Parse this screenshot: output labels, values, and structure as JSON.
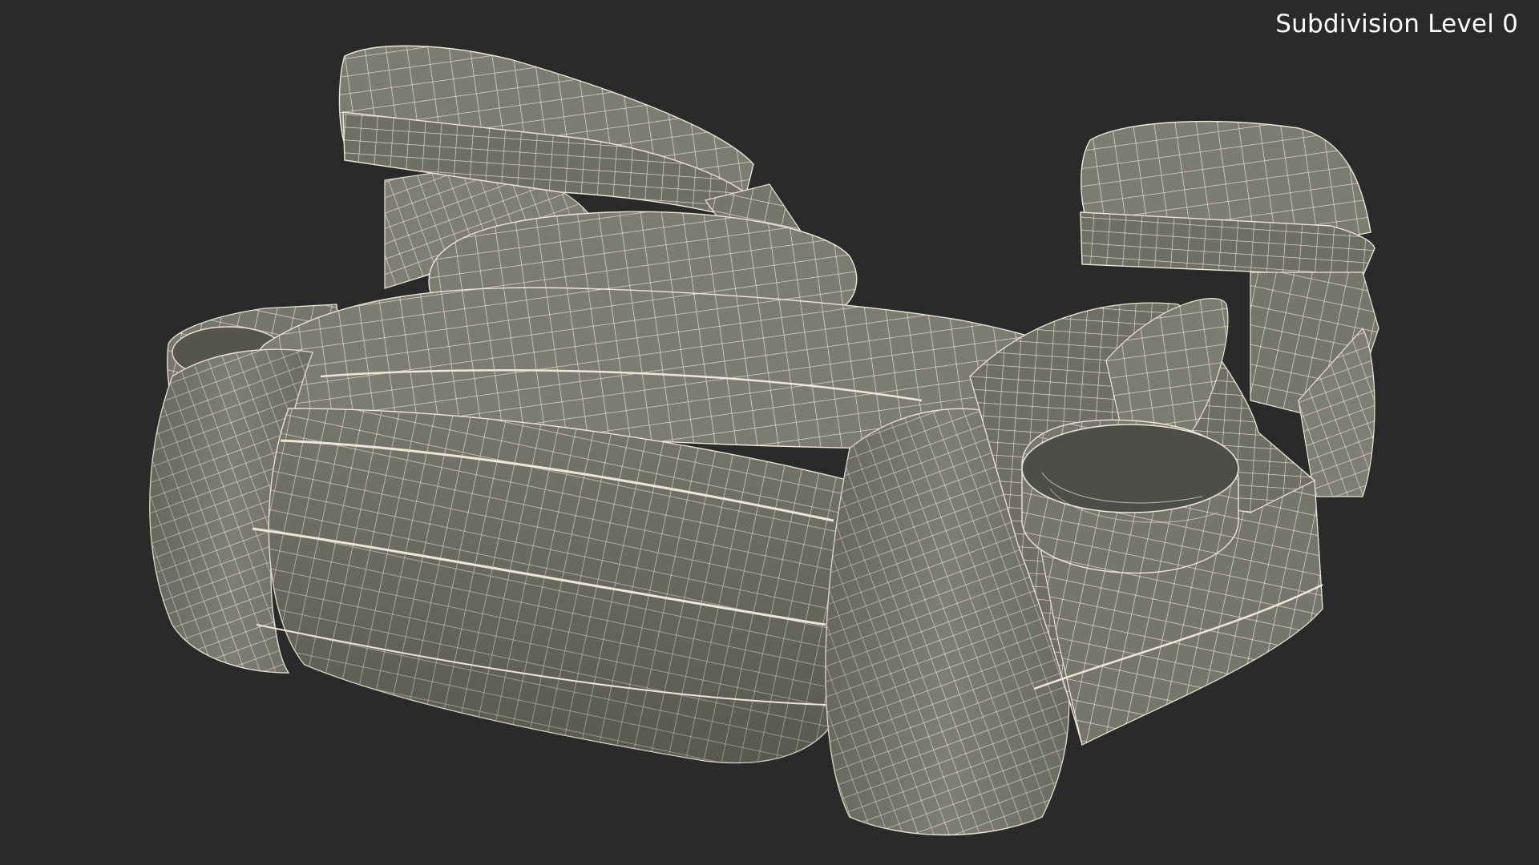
{
  "viewport": {
    "overlay_label": "Subdivision Level 0",
    "background_color": "#2a2a2a",
    "surface_color": "#7a7a70",
    "wire_color": "#ede8d8"
  },
  "model": {
    "subject": "booster-seat-wireframe"
  }
}
